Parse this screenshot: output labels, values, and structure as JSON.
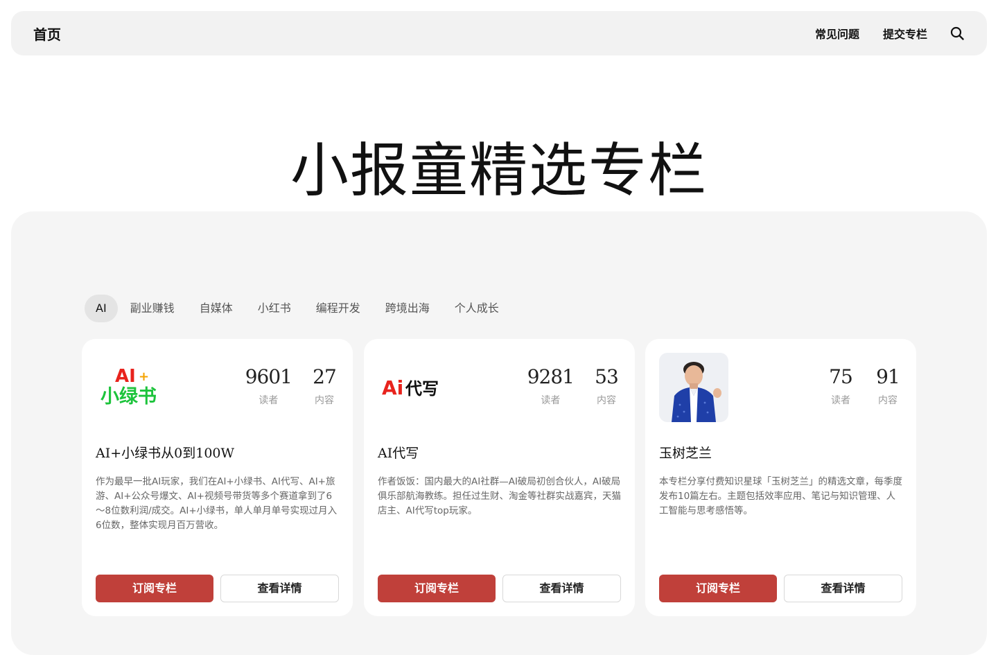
{
  "nav": {
    "home": "首页",
    "faq": "常见问题",
    "submit": "提交专栏",
    "search_icon": "search-icon"
  },
  "hero": {
    "title": "小报童精选专栏"
  },
  "tabs": [
    {
      "label": "AI",
      "active": true
    },
    {
      "label": "副业赚钱",
      "active": false
    },
    {
      "label": "自媒体",
      "active": false
    },
    {
      "label": "小红书",
      "active": false
    },
    {
      "label": "编程开发",
      "active": false
    },
    {
      "label": "跨境出海",
      "active": false
    },
    {
      "label": "个人成长",
      "active": false
    }
  ],
  "cards": [
    {
      "logo": {
        "line1": "AI",
        "plus": "+",
        "line2": "小绿书"
      },
      "readers": "9601",
      "readers_label": "读者",
      "contents": "27",
      "contents_label": "内容",
      "title": "AI+小绿书从0到100W",
      "desc": "作为最早一批AI玩家，我们在AI+小绿书、AI代写、AI+旅游、AI+公众号爆文、AI+视频号带货等多个赛道拿到了6～8位数利润/成交。AI+小绿书，单人单月单号实现过月入6位数，整体实现月百万营收。",
      "subscribe": "订阅专栏",
      "detail": "查看详情"
    },
    {
      "logo": {
        "ai": "Ai",
        "text": "代写"
      },
      "readers": "9281",
      "readers_label": "读者",
      "contents": "53",
      "contents_label": "内容",
      "title": "AI代写",
      "desc": "作者饭饭：国内最大的AI社群—AI破局初创合伙人，AI破局俱乐部航海教练。担任过生财、淘金等社群实战嘉宾，天猫店主、AI代写top玩家。",
      "subscribe": "订阅专栏",
      "detail": "查看详情"
    },
    {
      "logo": {
        "type": "avatar-photo"
      },
      "readers": "75",
      "readers_label": "读者",
      "contents": "91",
      "contents_label": "内容",
      "title": "玉树芝兰",
      "desc": "本专栏分享付费知识星球「玉树芝兰」的精选文章，每季度发布10篇左右。主题包括效率应用、笔记与知识管理、人工智能与思考感悟等。",
      "subscribe": "订阅专栏",
      "detail": "查看详情"
    }
  ],
  "colors": {
    "accent": "#c0403a",
    "logo_red": "#e8231d",
    "logo_green": "#1cc33b",
    "logo_plus": "#f5a300",
    "avatar_suit": "#1f3fa8"
  }
}
